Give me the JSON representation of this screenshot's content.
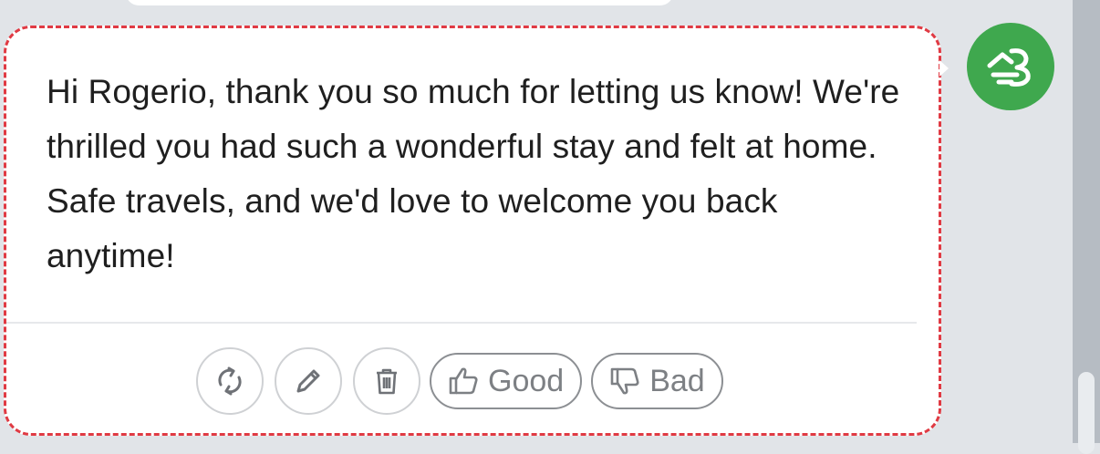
{
  "message": {
    "text": "Hi Rogerio, thank you so much for letting us know! We're thrilled you had such a wonderful stay and felt at home. Safe travels, and we'd love to welcome you back anytime!"
  },
  "actions": {
    "regenerate_icon": "refresh-icon",
    "edit_icon": "pencil-icon",
    "delete_icon": "trash-icon",
    "good_label": "Good",
    "bad_label": "Bad"
  },
  "avatar": {
    "icon": "host-logo-icon",
    "color": "#3fa84e"
  },
  "colors": {
    "selection_outline": "#e03a43",
    "bubble": "#ffffff",
    "background": "#e1e4e8"
  }
}
